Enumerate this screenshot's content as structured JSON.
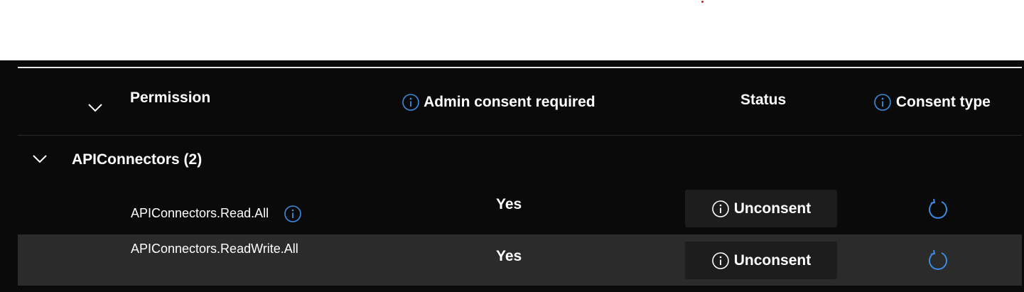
{
  "colors": {
    "panel_bg": "#0a0a0a",
    "alt_row_bg": "#2b2b2b",
    "button_bg": "#1d1d1d",
    "accent_blue": "#3a8de0",
    "text": "#ffffff"
  },
  "table": {
    "headers": {
      "permission": "Permission",
      "admin_consent": "Admin consent required",
      "status": "Status",
      "consent_type": "Consent type"
    },
    "group": {
      "label": "APIConnectors (2)"
    },
    "rows": [
      {
        "permission": "APIConnectors.Read.All",
        "admin_consent": "Yes",
        "status_button": "Unconsent"
      },
      {
        "permission": "APIConnectors.ReadWrite.All",
        "admin_consent": "Yes",
        "status_button": "Unconsent"
      }
    ]
  },
  "icons": {
    "header_chevron": "chevron-down-icon",
    "group_chevron": "chevron-down-icon",
    "info": "info-icon",
    "refresh": "refresh-icon"
  }
}
